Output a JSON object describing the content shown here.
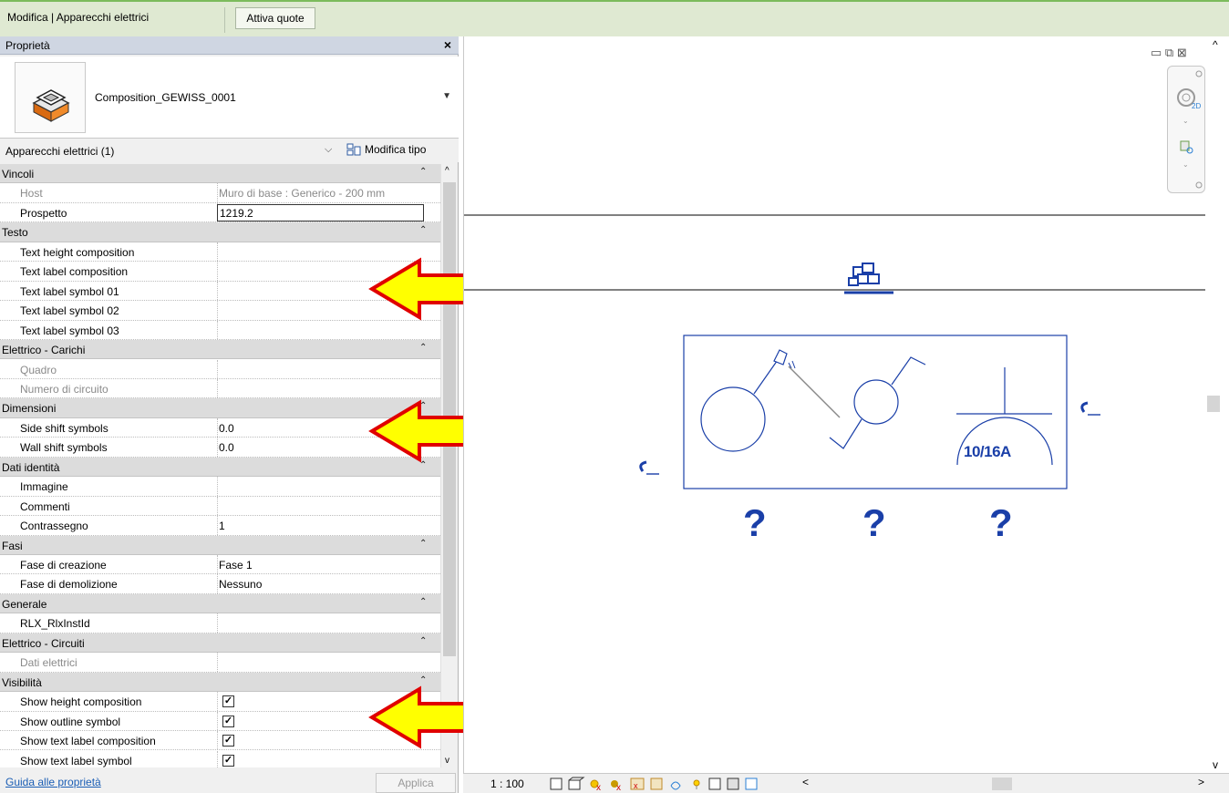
{
  "ribbon": {
    "context_title": "Modifica | Apparecchi elettrici",
    "button_label": "Attiva quote"
  },
  "properties": {
    "title": "Proprietà",
    "close_glyph": "×",
    "type_name": "Composition_GEWISS_0001",
    "instance_filter": "Apparecchi elettrici (1)",
    "edit_type_label": "Modifica tipo",
    "help_link": "Guida alle proprietà",
    "apply_label": "Applica",
    "rows": [
      {
        "kind": "group",
        "label": "Vincoli"
      },
      {
        "kind": "param",
        "label": "Host",
        "value": "Muro di base : Generico - 200 mm",
        "dim": true
      },
      {
        "kind": "param",
        "label": "Prospetto",
        "value": "1219.2",
        "editing": true
      },
      {
        "kind": "group",
        "label": "Testo"
      },
      {
        "kind": "param",
        "label": "Text height composition",
        "value": ""
      },
      {
        "kind": "param",
        "label": "Text label composition",
        "value": ""
      },
      {
        "kind": "param",
        "label": "Text label symbol 01",
        "value": ""
      },
      {
        "kind": "param",
        "label": "Text label symbol 02",
        "value": ""
      },
      {
        "kind": "param",
        "label": "Text label symbol 03",
        "value": ""
      },
      {
        "kind": "group",
        "label": "Elettrico - Carichi"
      },
      {
        "kind": "param",
        "label": "Quadro",
        "value": "",
        "dim": true
      },
      {
        "kind": "param",
        "label": "Numero di circuito",
        "value": "",
        "dim": true
      },
      {
        "kind": "group",
        "label": "Dimensioni"
      },
      {
        "kind": "param",
        "label": "Side shift symbols",
        "value": "0.0"
      },
      {
        "kind": "param",
        "label": "Wall shift symbols",
        "value": "0.0"
      },
      {
        "kind": "group",
        "label": "Dati identità"
      },
      {
        "kind": "param",
        "label": "Immagine",
        "value": ""
      },
      {
        "kind": "param",
        "label": "Commenti",
        "value": ""
      },
      {
        "kind": "param",
        "label": "Contrassegno",
        "value": "1"
      },
      {
        "kind": "group",
        "label": "Fasi"
      },
      {
        "kind": "param",
        "label": "Fase di creazione",
        "value": "Fase 1"
      },
      {
        "kind": "param",
        "label": "Fase di demolizione",
        "value": "Nessuno"
      },
      {
        "kind": "group",
        "label": "Generale"
      },
      {
        "kind": "param",
        "label": "RLX_RlxInstId",
        "value": ""
      },
      {
        "kind": "group",
        "label": "Elettrico - Circuiti"
      },
      {
        "kind": "param",
        "label": "Dati elettrici",
        "value": "",
        "dim": true
      },
      {
        "kind": "group",
        "label": "Visibilità"
      },
      {
        "kind": "check",
        "label": "Show height composition",
        "checked": true
      },
      {
        "kind": "check",
        "label": "Show outline symbol",
        "checked": true
      },
      {
        "kind": "check",
        "label": "Show text label composition",
        "checked": true
      },
      {
        "kind": "check",
        "label": "Show text label symbol",
        "checked": true
      }
    ]
  },
  "view": {
    "rating_label": "10/16A",
    "question_mark": "?",
    "scale": "1 : 100",
    "nav_2d_label": "2D"
  },
  "colors": {
    "symbol_blue": "#1a3fa8",
    "arrow_fill": "#ffff00",
    "arrow_stroke": "#e00000"
  }
}
